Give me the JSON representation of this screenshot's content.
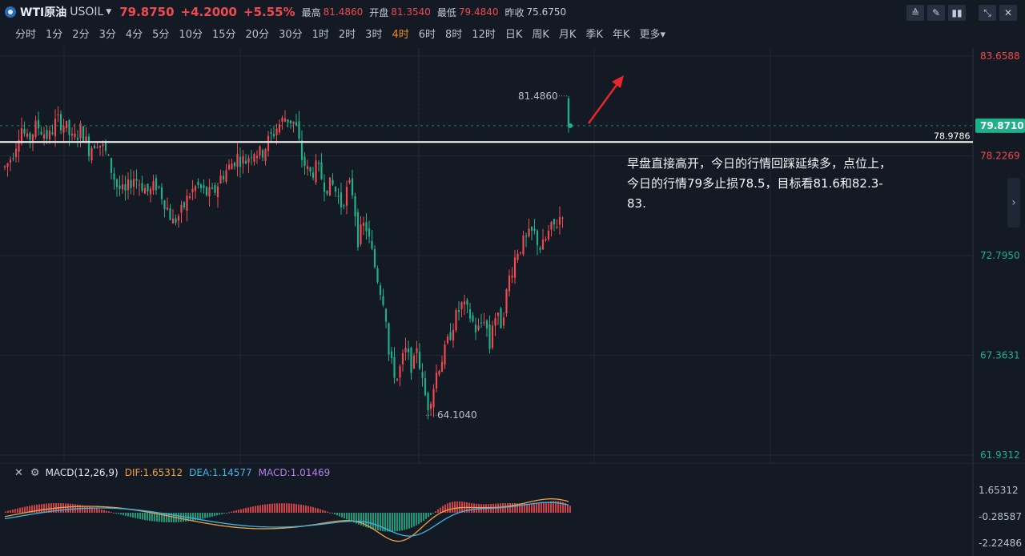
{
  "header": {
    "name": "WTI原油",
    "code": "USOIL",
    "price": "79.8750",
    "change": "+4.2000",
    "change_pct": "+5.55%",
    "high_label": "最高",
    "high": "81.4860",
    "open_label": "开盘",
    "open": "81.3540",
    "low_label": "最低",
    "low": "79.4840",
    "prev_label": "昨收",
    "prev": "75.6750"
  },
  "periods": [
    "分时",
    "1分",
    "2分",
    "3分",
    "4分",
    "5分",
    "10分",
    "15分",
    "20分",
    "30分",
    "1时",
    "2时",
    "3时",
    "4时",
    "6时",
    "8时",
    "12时",
    "日K",
    "周K",
    "月K",
    "季K",
    "年K",
    "更多"
  ],
  "active_period": "4时",
  "annotation": "早盘直接高开，今日的行情回踩延续多，点位上，今日的行情79多止损78.5，目标看81.6和82.3-83.",
  "horizontal_line_label": "78.9786",
  "current_price_tag": "79.8710",
  "macd": {
    "name": "MACD(12,26,9)",
    "dif": "DIF:1.65312",
    "dea": "DEA:1.14577",
    "macd": "MACD:1.01469",
    "axis": [
      "1.65312",
      "-0.28587",
      "-2.22486"
    ]
  },
  "colors": {
    "up": "#ef4a50",
    "down": "#1fb08a",
    "bg": "#131a24",
    "accent": "#f08a24"
  },
  "chart_data": [
    {
      "type": "candlestick",
      "ylim": [
        61.9312,
        83.6588
      ],
      "yticks": [
        "83.6588",
        "78.2269",
        "72.7950",
        "67.3631",
        "61.9312"
      ],
      "horizontal_line": 78.9786,
      "last_price": 79.871,
      "annotations": [
        {
          "text": "81.4860",
          "value": 81.486
        },
        {
          "text": "64.1040",
          "value": 64.104
        }
      ],
      "close_path": [
        [
          0,
          77.6
        ],
        [
          5,
          77.9
        ],
        [
          12,
          78.6
        ],
        [
          20,
          79.9
        ],
        [
          28,
          79.0
        ],
        [
          40,
          79.9
        ],
        [
          55,
          79.2
        ],
        [
          65,
          80.2
        ],
        [
          75,
          79.9
        ],
        [
          85,
          79.0
        ],
        [
          95,
          79.7
        ],
        [
          105,
          78.6
        ],
        [
          115,
          79.1
        ],
        [
          125,
          78.5
        ],
        [
          132,
          77.6
        ],
        [
          140,
          76.6
        ],
        [
          150,
          76.1
        ],
        [
          160,
          77.1
        ],
        [
          170,
          76.7
        ],
        [
          180,
          76.2
        ],
        [
          190,
          76.7
        ],
        [
          200,
          75.7
        ],
        [
          210,
          74.6
        ],
        [
          220,
          75.1
        ],
        [
          230,
          76.1
        ],
        [
          240,
          76.6
        ],
        [
          250,
          76.2
        ],
        [
          260,
          76.1
        ],
        [
          270,
          77.1
        ],
        [
          280,
          77.6
        ],
        [
          290,
          78.2
        ],
        [
          300,
          77.9
        ],
        [
          310,
          78.6
        ],
        [
          320,
          78.3
        ],
        [
          330,
          79.1
        ],
        [
          340,
          79.8
        ],
        [
          350,
          80.3
        ],
        [
          360,
          80.1
        ],
        [
          365,
          79.6
        ],
        [
          370,
          78.2
        ],
        [
          380,
          77.2
        ],
        [
          390,
          77.6
        ],
        [
          400,
          76.6
        ],
        [
          410,
          76.6
        ],
        [
          420,
          75.6
        ],
        [
          430,
          76.6
        ],
        [
          436,
          76.1
        ],
        [
          440,
          73.6
        ],
        [
          450,
          74.6
        ],
        [
          460,
          72.6
        ],
        [
          468,
          71.1
        ],
        [
          475,
          70.1
        ],
        [
          480,
          67.1
        ],
        [
          490,
          66.1
        ],
        [
          500,
          67.6
        ],
        [
          510,
          66.6
        ],
        [
          515,
          68.1
        ],
        [
          520,
          66.1
        ],
        [
          528,
          64.6
        ],
        [
          535,
          65.6
        ],
        [
          540,
          66.6
        ],
        [
          550,
          67.6
        ],
        [
          560,
          69.1
        ],
        [
          570,
          70.1
        ],
        [
          580,
          69.6
        ],
        [
          590,
          68.6
        ],
        [
          600,
          69.6
        ],
        [
          605,
          67.6
        ],
        [
          610,
          69.6
        ],
        [
          620,
          69.1
        ],
        [
          630,
          71.6
        ],
        [
          640,
          73.1
        ],
        [
          650,
          73.6
        ],
        [
          660,
          74.1
        ],
        [
          670,
          73.1
        ],
        [
          680,
          74.1
        ],
        [
          690,
          74.6
        ],
        [
          700,
          75.6
        ],
        [
          705,
          75.9
        ]
      ],
      "last_bar": {
        "open": 81.354,
        "high": 81.486,
        "low": 79.484,
        "close": 79.875
      }
    },
    {
      "type": "macd",
      "series": [
        {
          "name": "DIF",
          "value": 1.65312
        },
        {
          "name": "DEA",
          "value": 1.14577
        },
        {
          "name": "MACD",
          "value": 1.01469
        }
      ],
      "ylim": [
        -2.22486,
        1.65312
      ]
    }
  ]
}
